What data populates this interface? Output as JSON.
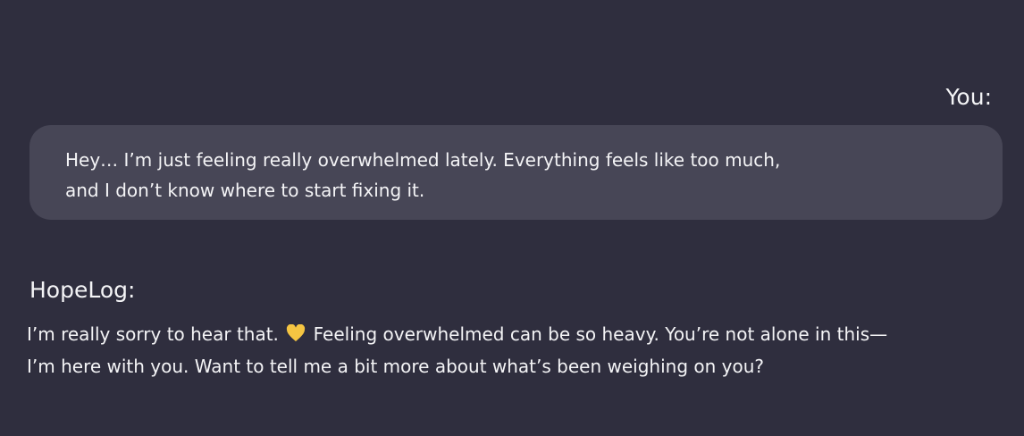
{
  "user": {
    "label": "You:",
    "message_lines": [
      "Hey… I’m just feeling really overwhelmed lately. Everything feels like too much,",
      "and I don’t know where to start fixing it."
    ]
  },
  "bot": {
    "label": "HopeLog:",
    "line1_before": "I’m really sorry to hear that. ",
    "emoji": "💛",
    "line1_after": " Feeling overwhelmed can be so heavy. You’re not alone in this—",
    "line2": "I’m here with you. Want to tell me a bit more about what’s been weighing on you?"
  },
  "colors": {
    "background": "#2f2e3e",
    "bubble": "#474656",
    "heart": "#f5c542"
  }
}
